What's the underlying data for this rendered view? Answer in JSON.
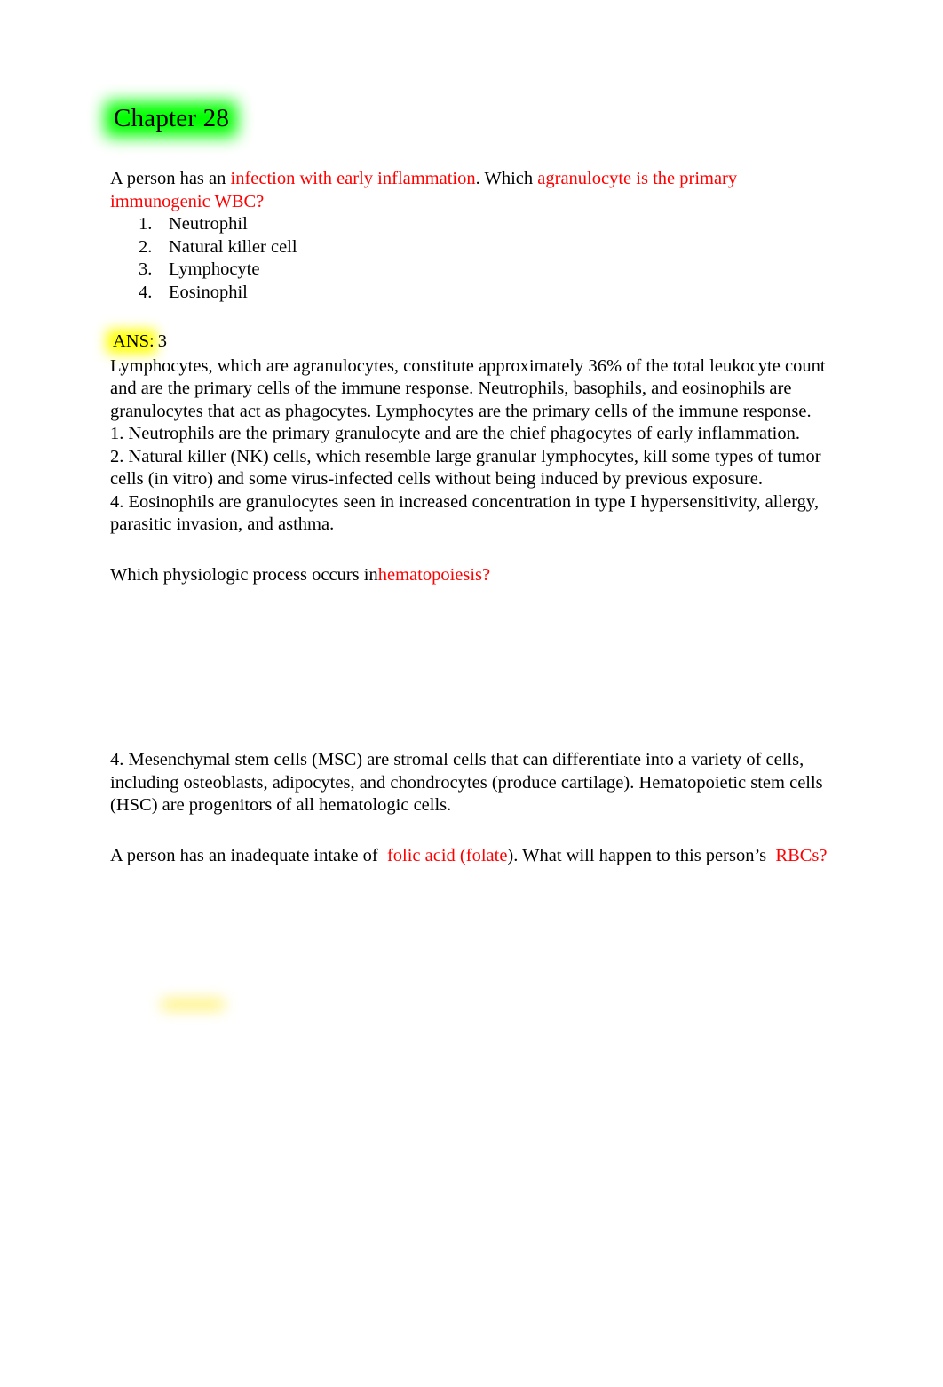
{
  "document": {
    "chapter_title": "Chapter 28",
    "highlight_colors": {
      "chapter": "#00ff00",
      "answer": "#ffff00"
    },
    "accent_color": "#ff0000"
  },
  "question1": {
    "lead": "A person has an ",
    "emphasis1": "infection with early inflammation",
    "middle": ". Which",
    "emphasis2": "agranulocyte is the primary immunogenic WBC?",
    "options": [
      {
        "num": "1.",
        "label": "Neutrophil"
      },
      {
        "num": "2.",
        "label": "Natural killer cell"
      },
      {
        "num": "3.",
        "label": "Lymphocyte"
      },
      {
        "num": "4.",
        "label": "Eosinophil"
      }
    ],
    "answer_label": "ANS:",
    "answer_value": "3",
    "rationale": "Lymphocytes, which are agranulocytes, constitute approximately 36% of the total leukocyte count and are the primary cells of the immune response. Neutrophils, basophils, and eosinophils are granulocytes that act as phagocytes. Lymphocytes are the primary cells of the immune response.",
    "distractors": [
      "1. Neutrophils are the primary granulocyte and are the chief phagocytes of early inflammation.",
      "2. Natural killer (NK) cells, which resemble large granular lymphocytes, kill some types of tumor cells (in vitro) and some virus-infected cells without being induced by previous exposure.",
      "4. Eosinophils are granulocytes seen in increased concentration in type I hypersensitivity, allergy, parasitic invasion, and asthma."
    ]
  },
  "question2": {
    "lead": "Which physiologic process occurs in",
    "emphasis": "hematopoiesis?",
    "rationale": "4. Mesenchymal stem cells (MSC) are stromal cells that can differentiate into a variety of cells, including osteoblasts, adipocytes, and chondrocytes (produce cartilage). Hematopoietic stem cells (HSC) are progenitors of all hematologic cells."
  },
  "question3": {
    "lead": "A person has an inadequate intake of ",
    "emphasis1": "folic acid (folate",
    "middle": "). What will happen to this person’s ",
    "emphasis2": "RBCs?"
  }
}
